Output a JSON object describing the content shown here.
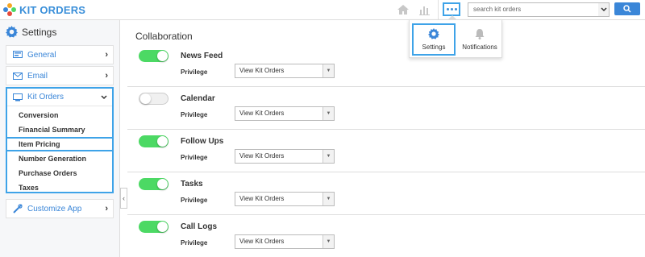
{
  "app": {
    "title": "KIT ORDERS"
  },
  "header": {
    "search_placeholder": "search kit orders",
    "icons": [
      "home-icon",
      "chart-icon",
      "more-icon",
      "search-icon"
    ]
  },
  "popup": {
    "settings_label": "Settings",
    "notifications_label": "Notifications"
  },
  "sidebar": {
    "title": "Settings",
    "items": [
      {
        "label": "General",
        "icon": "general-icon"
      },
      {
        "label": "Email",
        "icon": "email-icon"
      },
      {
        "label": "Kit Orders",
        "icon": "kit-orders-icon"
      },
      {
        "label": "Customize App",
        "icon": "tools-icon"
      }
    ],
    "sub_items": [
      {
        "label": "Conversion"
      },
      {
        "label": "Financial Summary"
      },
      {
        "label": "Item Pricing"
      },
      {
        "label": "Number Generation"
      },
      {
        "label": "Purchase Orders"
      },
      {
        "label": "Taxes"
      }
    ]
  },
  "main": {
    "title": "Collaboration",
    "privilege_label": "Privilege",
    "rows": [
      {
        "label": "News Feed",
        "enabled": true,
        "privilege": "View Kit Orders"
      },
      {
        "label": "Calendar",
        "enabled": false,
        "privilege": "View Kit Orders"
      },
      {
        "label": "Follow Ups",
        "enabled": true,
        "privilege": "View Kit Orders"
      },
      {
        "label": "Tasks",
        "enabled": true,
        "privilege": "View Kit Orders"
      },
      {
        "label": "Call Logs",
        "enabled": true,
        "privilege": "View Kit Orders"
      }
    ]
  },
  "colors": {
    "accent": "#3a86d8",
    "highlight_border": "#3ea3e8",
    "toggle_on": "#4cd964"
  }
}
